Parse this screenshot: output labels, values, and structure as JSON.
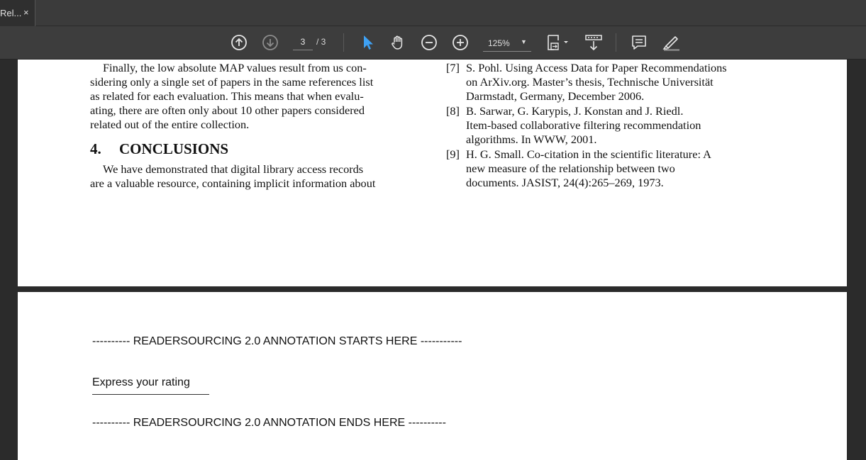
{
  "tab": {
    "label": "Rel...",
    "close": "×"
  },
  "toolbar": {
    "page_current": "3",
    "page_total": "/ 3",
    "zoom": "125%"
  },
  "page1": {
    "left_col": {
      "para1": [
        "Finally, the low absolute MAP values result from us con-",
        "sidering only a single set of papers in the same references list",
        "as related for each evaluation.  This means that when evalu-",
        "ating, there are often only about 10 other papers considered",
        "related out of the entire collection."
      ],
      "section_number": "4.",
      "section_title": "CONCLUSIONS",
      "para2": [
        "We have demonstrated that digital library access records",
        "are a valuable resource, containing implicit information about"
      ]
    },
    "references": [
      {
        "num": "[7]",
        "lines": [
          "S. Pohl. Using Access Data for Paper Recommendations",
          "on ArXiv.org. Master’s thesis, Technische Universität",
          "Darmstadt, Germany, December 2006."
        ]
      },
      {
        "num": "[8]",
        "lines": [
          "B. Sarwar, G. Karypis, J. Konstan and J. Riedl.",
          "Item-based collaborative filtering recommendation",
          "algorithms. In WWW, 2001."
        ]
      },
      {
        "num": "[9]",
        "lines": [
          "H. G. Small. Co-citation in the scientific literature: A",
          "new measure of the relationship between two",
          "documents. JASIST, 24(4):265–269, 1973."
        ]
      }
    ]
  },
  "page2": {
    "start_marker": "---------- READERSOURCING 2.0 ANNOTATION STARTS HERE -----------",
    "rating_label": "Express your rating",
    "end_marker": "---------- READERSOURCING 2.0 ANNOTATION ENDS HERE ----------"
  }
}
